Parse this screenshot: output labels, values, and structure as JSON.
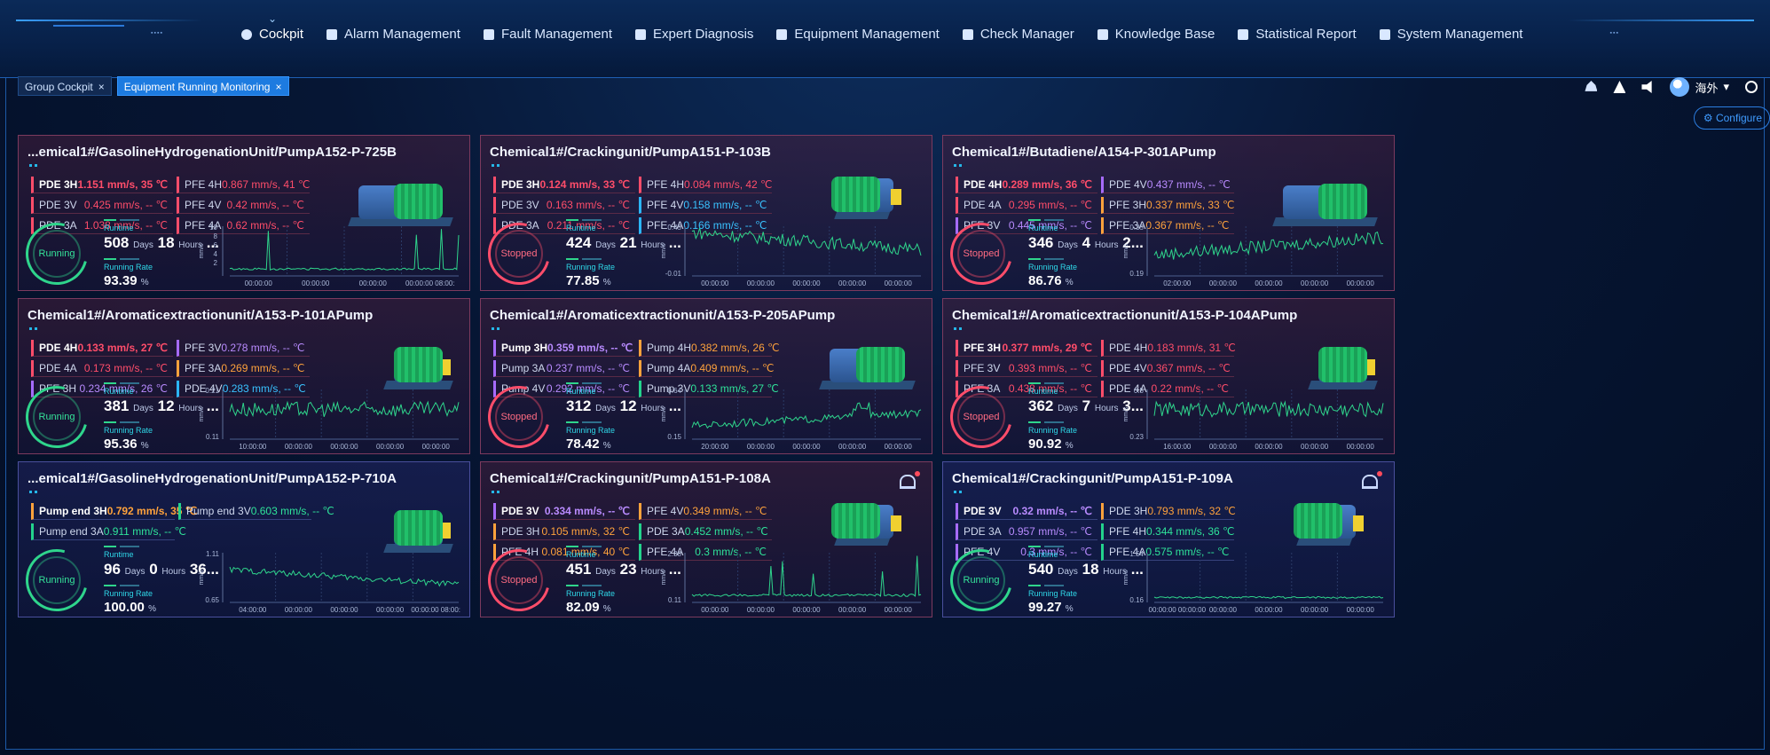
{
  "nav": [
    {
      "label": "Cockpit",
      "icon": "cockpit-icon",
      "active": true
    },
    {
      "label": "Alarm Management",
      "icon": "alarm-icon"
    },
    {
      "label": "Fault Management",
      "icon": "wrench-icon"
    },
    {
      "label": "Expert Diagnosis",
      "icon": "user-icon"
    },
    {
      "label": "Equipment Management",
      "icon": "grid-icon"
    },
    {
      "label": "Check Manager",
      "icon": "check-icon"
    },
    {
      "label": "Knowledge Base",
      "icon": "book-icon"
    },
    {
      "label": "Statistical Report",
      "icon": "report-icon"
    },
    {
      "label": "System Management",
      "icon": "gear-icon"
    }
  ],
  "tabs": [
    {
      "label": "Group Cockpit"
    },
    {
      "label": "Equipment Running Monitoring"
    }
  ],
  "user": {
    "name": "海外"
  },
  "configure_label": "Configure",
  "cards": [
    {
      "title": "...emical1#/GasolineHydrogenationUnit/PumpA152-P-725B",
      "status": "Running",
      "alarm": false,
      "params": [
        [
          "PDE 3H",
          "1.151 mm/s, 35 ℃",
          "red",
          true
        ],
        [
          "PFE 4H",
          "0.867 mm/s, 41 ℃",
          "red",
          false
        ],
        [
          "PDE 3V",
          "0.425 mm/s, -- ℃",
          "red",
          false
        ],
        [
          "PFE 4V",
          "0.42 mm/s, -- ℃",
          "red",
          false
        ],
        [
          "PDE 3A",
          "1.038 mm/s, -- ℃",
          "red",
          false
        ],
        [
          "PFE 4A",
          "0.62 mm/s, -- ℃",
          "red",
          false
        ]
      ],
      "runtime": {
        "days": "508",
        "hours": "18",
        "more": "..."
      },
      "rate": "93.39",
      "y_max": "10",
      "y_min": "",
      "y_ticks": [
        "10",
        "8",
        "6",
        "4",
        "2"
      ],
      "unit": "mm/s",
      "x_ticks": [
        "00:00:00",
        "00:00:00",
        "00:00:00",
        "00:00:00 08:00:"
      ],
      "pattern": "spiky",
      "pump": "big"
    },
    {
      "title": "Chemical1#/Crackingunit/PumpA151-P-103B",
      "status": "Stopped",
      "alarm": false,
      "params": [
        [
          "PDE 3H",
          "0.124 mm/s, 33 ℃",
          "red",
          true
        ],
        [
          "PFE 4H",
          "0.084 mm/s, 42 ℃",
          "red",
          false
        ],
        [
          "PDE 3V",
          "0.163 mm/s, -- ℃",
          "red",
          false
        ],
        [
          "PFE 4V",
          "0.158 mm/s, -- ℃",
          "blu",
          false
        ],
        [
          "PDE 3A",
          "0.211 mm/s, -- ℃",
          "red",
          false
        ],
        [
          "PFE 4A",
          "0.166 mm/s, -- ℃",
          "blu",
          false
        ]
      ],
      "runtime": {
        "days": "424",
        "hours": "21",
        "more": "..."
      },
      "rate": "77.85",
      "y_max": "0.45",
      "y_min": "-0.01",
      "y_ticks": [],
      "unit": "mm/s",
      "x_ticks": [
        "00:00:00",
        "00:00:00",
        "00:00:00",
        "00:00:00",
        "00:00:00"
      ],
      "pattern": "noisy-down",
      "pump": "small"
    },
    {
      "title": "Chemical1#/Butadiene/A154-P-301APump",
      "status": "Stopped",
      "alarm": false,
      "params": [
        [
          "PDE 4H",
          "0.289 mm/s, 36 ℃",
          "red",
          true
        ],
        [
          "PDE 4V",
          "0.437 mm/s, -- ℃",
          "pur",
          false
        ],
        [
          "PDE 4A",
          "0.295 mm/s, -- ℃",
          "red",
          false
        ],
        [
          "PFE 3H",
          "0.337 mm/s, 33 ℃",
          "ora",
          false
        ],
        [
          "PFE 3V",
          "0.445 mm/s, -- ℃",
          "pur",
          false
        ],
        [
          "PFE 3A",
          "0.367 mm/s, -- ℃",
          "ora",
          false
        ]
      ],
      "runtime": {
        "days": "346",
        "hours": "4",
        "more": "2..."
      },
      "rate": "86.76",
      "y_max": "0.35",
      "y_min": "0.19",
      "y_ticks": [],
      "unit": "mm/s",
      "x_ticks": [
        "02:00:00",
        "00:00:00",
        "00:00:00",
        "00:00:00",
        "00:00:00"
      ],
      "pattern": "noisy-up",
      "pump": "big"
    },
    {
      "title": "Chemical1#/Aromaticextractionunit/A153-P-101APump",
      "status": "Running",
      "alarm": false,
      "params": [
        [
          "PDE 4H",
          "0.133 mm/s, 27 ℃",
          "red",
          true
        ],
        [
          "PFE 3V",
          "0.278 mm/s, -- ℃",
          "pur",
          false
        ],
        [
          "PDE 4A",
          "0.173 mm/s, -- ℃",
          "red",
          false
        ],
        [
          "PFE 3A",
          "0.269 mm/s, -- ℃",
          "ora",
          false
        ],
        [
          "PFE 3H",
          "0.234 mm/s, 26 ℃",
          "pur",
          false
        ],
        [
          "PDE 4V",
          "0.283 mm/s, -- ℃",
          "blu",
          false
        ]
      ],
      "runtime": {
        "days": "381",
        "hours": "12",
        "more": "..."
      },
      "rate": "95.36",
      "y_max": "0.21",
      "y_min": "0.11",
      "y_ticks": [],
      "unit": "mm/s",
      "x_ticks": [
        "10:00:00",
        "00:00:00",
        "00:00:00",
        "00:00:00",
        "00:00:00"
      ],
      "pattern": "noisy",
      "pump": "mid"
    },
    {
      "title": "Chemical1#/Aromaticextractionunit/A153-P-205APump",
      "status": "Stopped",
      "alarm": false,
      "params": [
        [
          "Pump 3H",
          "0.359 mm/s, -- ℃",
          "pur",
          true
        ],
        [
          "Pump 4H",
          "0.382 mm/s, 26 ℃",
          "ora",
          false
        ],
        [
          "Pump 3A",
          "0.237 mm/s, -- ℃",
          "pur",
          false
        ],
        [
          "Pump 4A",
          "0.409 mm/s, -- ℃",
          "ora",
          false
        ],
        [
          "Pump 4V",
          "0.292 mm/s, -- ℃",
          "pur",
          false
        ],
        [
          "Pump 3V",
          "0.133 mm/s, 27 ℃",
          "grn",
          false
        ]
      ],
      "runtime": {
        "days": "312",
        "hours": "12",
        "more": "..."
      },
      "rate": "78.42",
      "y_max": "0.64",
      "y_min": "0.15",
      "y_ticks": [],
      "unit": "mm/s",
      "x_ticks": [
        "20:00:00",
        "00:00:00",
        "00:00:00",
        "00:00:00",
        "00:00:00"
      ],
      "pattern": "rising",
      "pump": "large"
    },
    {
      "title": "Chemical1#/Aromaticextractionunit/A153-P-104APump",
      "status": "Stopped",
      "alarm": false,
      "params": [
        [
          "PFE 3H",
          "0.377 mm/s, 29 ℃",
          "red",
          true
        ],
        [
          "PDE 4H",
          "0.183 mm/s, 31 ℃",
          "red",
          false
        ],
        [
          "PFE 3V",
          "0.393 mm/s, -- ℃",
          "red",
          false
        ],
        [
          "PDE 4V",
          "0.367 mm/s, -- ℃",
          "red",
          false
        ],
        [
          "PFE 3A",
          "0.438 mm/s, -- ℃",
          "red",
          false
        ],
        [
          "PDE 4A",
          "0.22 mm/s, -- ℃",
          "red",
          false
        ]
      ],
      "runtime": {
        "days": "362",
        "hours": "7",
        "more": "3..."
      },
      "rate": "90.92",
      "y_max": "0.5",
      "y_min": "0.23",
      "y_ticks": [],
      "unit": "mm/s",
      "x_ticks": [
        "16:00:00",
        "00:00:00",
        "00:00:00",
        "00:00:00",
        "00:00:00"
      ],
      "pattern": "noisy",
      "pump": "mid"
    },
    {
      "title": "...emical1#/GasolineHydrogenationUnit/PumpA152-P-710A",
      "status": "Running",
      "alarm": false,
      "params": [
        [
          "Pump end 3H",
          "0.792 mm/s, 35 ℃",
          "ora",
          true
        ],
        [
          "Pump end 3V",
          "0.603 mm/s, -- ℃",
          "grn",
          false
        ],
        [
          "Pump end 3A",
          "0.911 mm/s, -- ℃",
          "grn",
          false
        ]
      ],
      "runtime": {
        "days": "96",
        "hours": "0",
        "more": "36..."
      },
      "rate": "100.00",
      "y_max": "1.11",
      "y_min": "0.65",
      "y_ticks": [],
      "unit": "mm/s",
      "x_ticks": [
        "04:00:00",
        "00:00:00",
        "00:00:00",
        "00:00:00",
        "00:00:00 08:00:"
      ],
      "pattern": "falling",
      "pump": "mid"
    },
    {
      "title": "Chemical1#/Crackingunit/PumpA151-P-108A",
      "status": "Stopped",
      "alarm": true,
      "params": [
        [
          "PDE 3V",
          "0.334 mm/s, -- ℃",
          "pur",
          true
        ],
        [
          "PFE 4V",
          "0.349 mm/s, -- ℃",
          "ora",
          false
        ],
        [
          "PDE 3H",
          "0.105 mm/s, 32 ℃",
          "ora",
          false
        ],
        [
          "PDE 3A",
          "0.452 mm/s, -- ℃",
          "grn",
          false
        ],
        [
          "PFE 4H",
          "0.081 mm/s, 40 ℃",
          "ora",
          false
        ],
        [
          "PFE 4A",
          "0.3 mm/s, -- ℃",
          "grn",
          false
        ]
      ],
      "runtime": {
        "days": "451",
        "hours": "23",
        "more": "..."
      },
      "rate": "82.09",
      "y_max": "2.38",
      "y_min": "0.11",
      "y_ticks": [],
      "unit": "mm/s",
      "x_ticks": [
        "00:00:00",
        "00:00:00",
        "00:00:00",
        "00:00:00",
        "00:00:00"
      ],
      "pattern": "spiky2",
      "pump": "small"
    },
    {
      "title": "Chemical1#/Crackingunit/PumpA151-P-109A",
      "status": "Running",
      "alarm": true,
      "params": [
        [
          "PDE 3V",
          "0.32 mm/s, -- ℃",
          "pur",
          true
        ],
        [
          "PDE 3H",
          "0.793 mm/s, 32 ℃",
          "ora",
          false
        ],
        [
          "PDE 3A",
          "0.957 mm/s, -- ℃",
          "pur",
          false
        ],
        [
          "PFE 4H",
          "0.344 mm/s, 36 ℃",
          "grn",
          false
        ],
        [
          "PFE 4V",
          "0.3 mm/s, -- ℃",
          "pur",
          false
        ],
        [
          "PFE 4A",
          "0.575 mm/s, -- ℃",
          "grn",
          false
        ]
      ],
      "runtime": {
        "days": "540",
        "hours": "18",
        "more": "..."
      },
      "rate": "99.27",
      "y_max": "1.54",
      "y_min": "0.16",
      "y_ticks": [],
      "unit": "mm/s",
      "x_ticks": [
        "00:00:00 00:00:00",
        "00:00:00",
        "00:00:00",
        "00:00:00",
        "00:00:00"
      ],
      "pattern": "spiky3",
      "pump": "small"
    }
  ],
  "labels": {
    "runtime": "Runtime",
    "running_rate": "Running Rate",
    "days": "Days",
    "hours": "Hours",
    "percent": "%"
  }
}
